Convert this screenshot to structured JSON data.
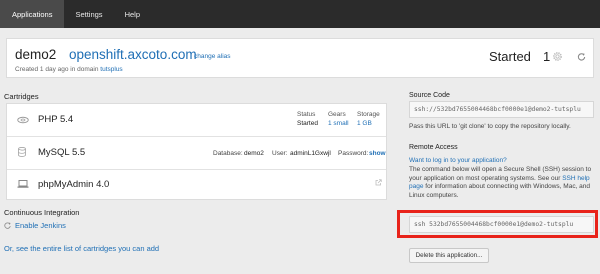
{
  "nav": {
    "tabs": [
      {
        "label": "Applications",
        "active": true
      },
      {
        "label": "Settings",
        "active": false
      },
      {
        "label": "Help",
        "active": false
      }
    ]
  },
  "app": {
    "name": "demo2",
    "url": "openshift.axcoto.com",
    "change_alias": "change alias",
    "created_prefix": "Created 1 day ago in domain ",
    "domain": "tutsplus",
    "status": "Started",
    "gear_count": "1"
  },
  "cartridges": {
    "title": "Cartridges",
    "status_label": "Status",
    "gears_label": "Gears",
    "storage_label": "Storage",
    "php": {
      "name": "PHP 5.4",
      "status": "Started",
      "gears": "1 small",
      "storage": "1 GB"
    },
    "mysql": {
      "name": "MySQL 5.5",
      "db_label": "Database:",
      "db_value": "demo2",
      "user_label": "User:",
      "user_value": "adminL1Gxwjl",
      "pass_label": "Password:",
      "pass_link": "show"
    },
    "phpmyadmin": {
      "name": "phpMyAdmin 4.0"
    }
  },
  "ci": {
    "title": "Continuous Integration",
    "enable_jenkins": "Enable Jenkins",
    "see_all": "Or, see the entire list of cartridges you can add"
  },
  "source": {
    "title": "Source Code",
    "url": "ssh://532bd7655004468bcf0000e1@demo2-tutsplu",
    "hint": "Pass this URL to 'git clone' to copy the repository locally."
  },
  "remote": {
    "title": "Remote Access",
    "question": "Want to log in to your application?",
    "desc_1": "The command below will open a Secure Shell (SSH) session to your application on most operating systems. See our ",
    "desc_link": "SSH help page",
    "desc_2": " for information about connecting with Windows, Mac, and Linux computers.",
    "ssh_cmd": "ssh 532bd7655004468bcf0000e1@demo2-tutsplu"
  },
  "delete_button": "Delete this application...",
  "colors": {
    "nav_bg": "#2b2b2b",
    "link": "#1f6fb5",
    "highlight": "#e8231a"
  }
}
